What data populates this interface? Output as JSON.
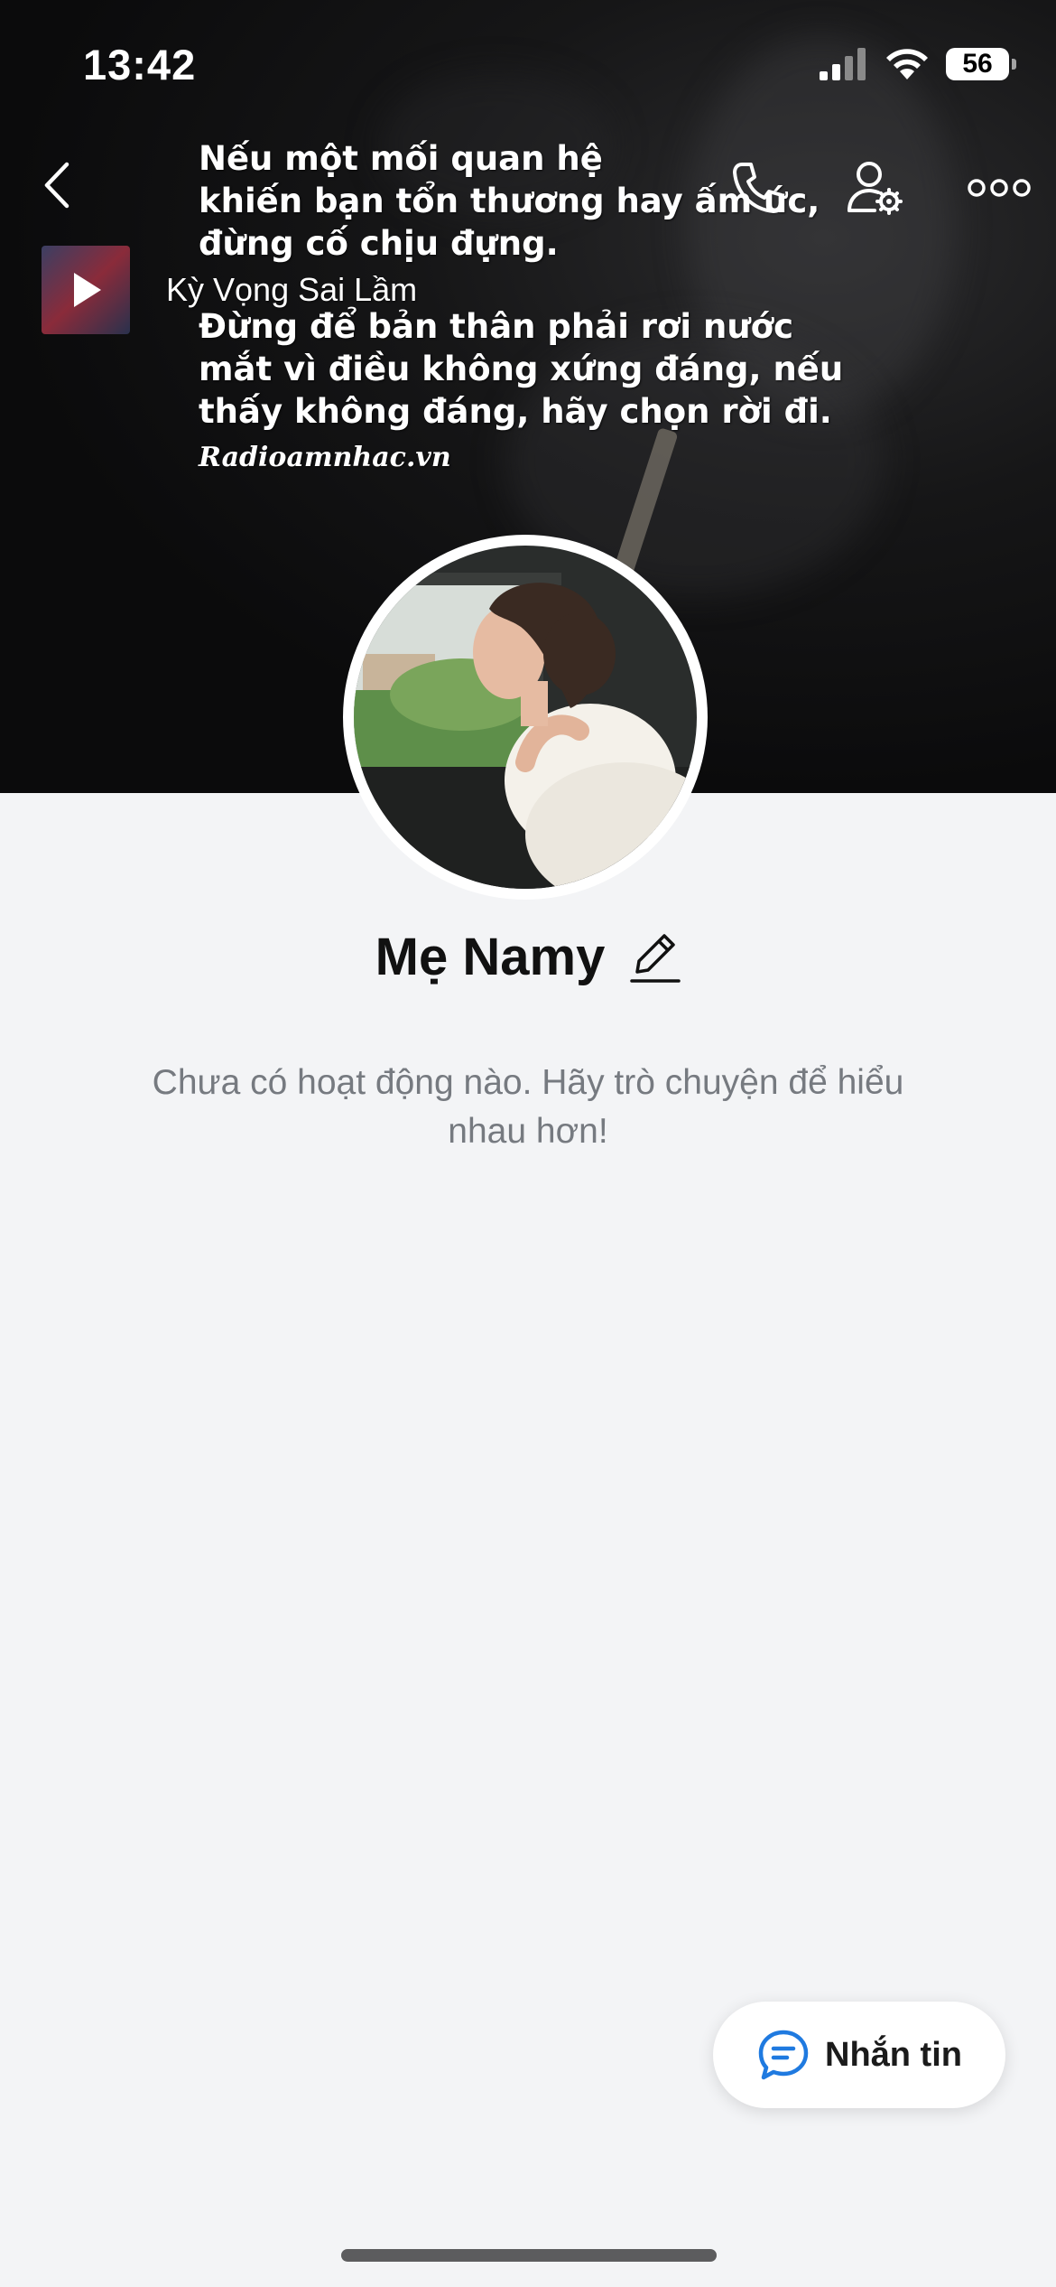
{
  "status_bar": {
    "time": "13:42",
    "battery": "56"
  },
  "cover": {
    "quote_lines": [
      "Nếu một mối quan hệ",
      "khiến bạn tổn thương hay ấm ức,",
      "đừng cố chịu đựng."
    ],
    "quote_lines_2": [
      "Đừng để bản thân phải rơi nước",
      "mắt vì điều không xứng đáng, nếu",
      "thấy không đáng, hãy chọn rời đi."
    ],
    "quote_source": "Radioamnhac.vn"
  },
  "music": {
    "song_title": "Kỳ Vọng Sai Lầm"
  },
  "profile": {
    "name": "Mẹ Namy",
    "empty_message": "Chưa có hoạt động nào. Hãy trò chuyện để hiểu nhau hơn!"
  },
  "actions": {
    "message_label": "Nhắn tin"
  },
  "colors": {
    "accent": "#1f7ae0",
    "background": "#f3f4f6"
  },
  "icons": {
    "back": "chevron-left-icon",
    "call": "phone-icon",
    "settings": "user-settings-icon",
    "more": "more-icon",
    "edit": "pencil-icon",
    "message": "chat-bubble-icon"
  }
}
